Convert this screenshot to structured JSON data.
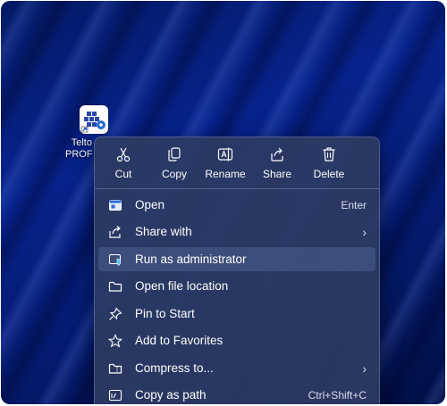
{
  "desktop": {
    "icon_label_line1": "Telto",
    "icon_label_line2": "PROFI"
  },
  "toolbar": [
    {
      "label": "Cut",
      "icon": "scissors-icon"
    },
    {
      "label": "Copy",
      "icon": "copy-icon"
    },
    {
      "label": "Rename",
      "icon": "rename-icon"
    },
    {
      "label": "Share",
      "icon": "share-icon"
    },
    {
      "label": "Delete",
      "icon": "trash-icon"
    }
  ],
  "menu": [
    {
      "label": "Open",
      "shortcut": "Enter",
      "icon": "open-window-icon",
      "submenu": false
    },
    {
      "label": "Share with",
      "shortcut": "",
      "icon": "share-icon",
      "submenu": true
    },
    {
      "label": "Run as administrator",
      "shortcut": "",
      "icon": "shield-window-icon",
      "submenu": false,
      "hovered": true
    },
    {
      "label": "Open file location",
      "shortcut": "",
      "icon": "folder-icon",
      "submenu": false
    },
    {
      "label": "Pin to Start",
      "shortcut": "",
      "icon": "pin-icon",
      "submenu": false
    },
    {
      "label": "Add to Favorites",
      "shortcut": "",
      "icon": "star-icon",
      "submenu": false
    },
    {
      "label": "Compress to...",
      "shortcut": "",
      "icon": "zip-folder-icon",
      "submenu": true
    },
    {
      "label": "Copy as path",
      "shortcut": "Ctrl+Shift+C",
      "icon": "path-icon",
      "submenu": false
    }
  ],
  "colors": {
    "accent": "#4cc2ff",
    "menu_bg": "#2c3a62",
    "desktop_bg": "#06238c"
  }
}
